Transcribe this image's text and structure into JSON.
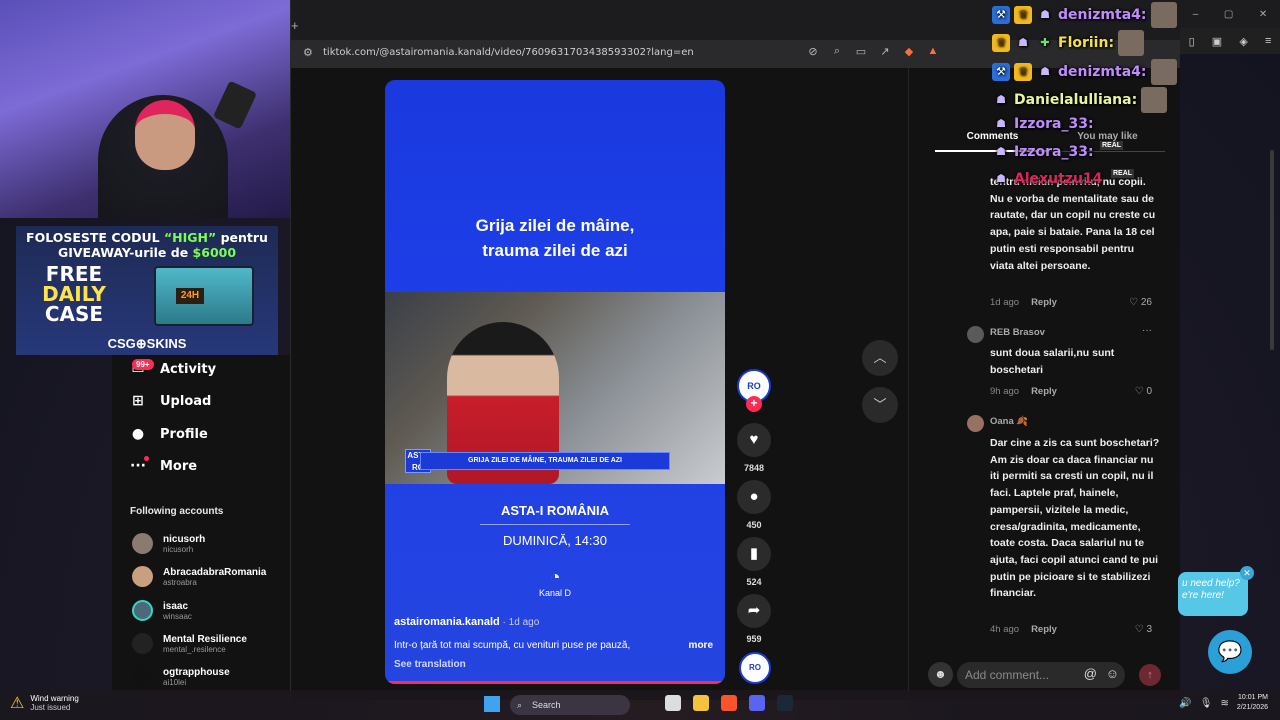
{
  "browser": {
    "url": "tiktok.com/@astairomania.kanald/video/7609631703438593302?lang=en",
    "new_tab": "+"
  },
  "sidebar": {
    "items": [
      {
        "label": "Activity",
        "icon": "inbox-icon",
        "badge": "99+"
      },
      {
        "label": "Upload",
        "icon": "plus-square-icon"
      },
      {
        "label": "Profile",
        "icon": "profile-icon"
      },
      {
        "label": "More",
        "icon": "more-dots-icon"
      }
    ],
    "following_title": "Following accounts",
    "accounts": [
      {
        "name": "nicusorh",
        "handle": "nicusorh"
      },
      {
        "name": "AbracadabraRomania",
        "handle": "astroabra"
      },
      {
        "name": "isaac",
        "handle": "winsaac"
      },
      {
        "name": "Mental Resilience",
        "handle": "mental_.resilence"
      },
      {
        "name": "ogtrapphouse",
        "handle": "ai10lei"
      }
    ]
  },
  "video": {
    "title_line1": "Grija zilei de mâine,",
    "title_line2": "trauma zilei de azi",
    "lower_third": "GRIJA ZILEI DE MÂINE, TRAUMA ZILEI DE AZI",
    "channel_logo": "ASTA RO",
    "show_name": "ASTA-I ROMÂNIA",
    "schedule": "DUMINICĂ, 14:30",
    "brand": "Kanal D",
    "author": "astairomania.kanald",
    "posted": " · 1d ago",
    "description": "Într-o țară tot mai scumpă, cu venituri puse pe pauză,",
    "more": "more",
    "see_translation": "See translation"
  },
  "actions": {
    "avatar_label": "RO",
    "likes": "7848",
    "comments": "450",
    "saves": "524",
    "shares": "959"
  },
  "comments_panel": {
    "tab_comments": "Comments",
    "tab_you_may_like": "You may like",
    "items": [
      {
        "author": "",
        "text": "tentru niciun peinvitu, nu copii. Nu e vorba de mentalitate sau de rautate, dar un copil nu creste cu apa, paie si bataie. Pana la 18 cel putin esti responsabil pentru viata altei persoane.",
        "time": "1d ago",
        "reply": "Reply",
        "likes": "26"
      },
      {
        "author": "REB Brasov",
        "text": "sunt doua salarii,nu sunt boschetari",
        "time": "9h ago",
        "reply": "Reply",
        "likes": "0"
      },
      {
        "author": "Oana 🍂",
        "text": "Dar cine a zis ca sunt boschetari? Am zis doar ca daca financiar nu iti permiti sa cresti un copil, nu il faci. Laptele praf, hainele, pampersii, vizitele la medic, cresa/gradinita, medicamente, toate costa. Daca salariul nu te ajuta, faci copil atunci cand te pui putin pe picioare si te stabilizezi financiar.",
        "time": "4h ago",
        "reply": "Reply",
        "likes": "3"
      }
    ],
    "input_placeholder": "Add comment..."
  },
  "promo": {
    "line1_a": "FOLOSESTE CODUL ",
    "line1_code": "“HIGH”",
    "line1_b": " pentru",
    "line2_a": "GIVEAWAY-urile de ",
    "line2_amount": "$6000",
    "free": "FREE",
    "daily": "DAILY",
    "case": "CASE",
    "timer": "24H",
    "brand": "CSG⊕SKINS"
  },
  "chat": [
    {
      "user": "denizmta4:",
      "color": "#c08cff"
    },
    {
      "user": "Floriin:",
      "color": "#f4e14a"
    },
    {
      "user": "denizmta4:",
      "color": "#c08cff"
    },
    {
      "user": "Danielalulliana:",
      "color": "#e8f59a"
    },
    {
      "user": "Izzora_33:",
      "color": "#c08cff"
    },
    {
      "user": "Izzora_33:",
      "color": "#c08cff"
    },
    {
      "user": "Alexutzu14",
      "color": "#e0245e"
    }
  ],
  "chat_tag_real": "REAL",
  "help_widget": {
    "line1": "u need help?",
    "line2": "e're here!"
  },
  "taskbar": {
    "weather_title": "Wind warning",
    "weather_sub": "Just issued",
    "search": "Search",
    "time": "10:01 PM",
    "date": "2/21/2026"
  }
}
